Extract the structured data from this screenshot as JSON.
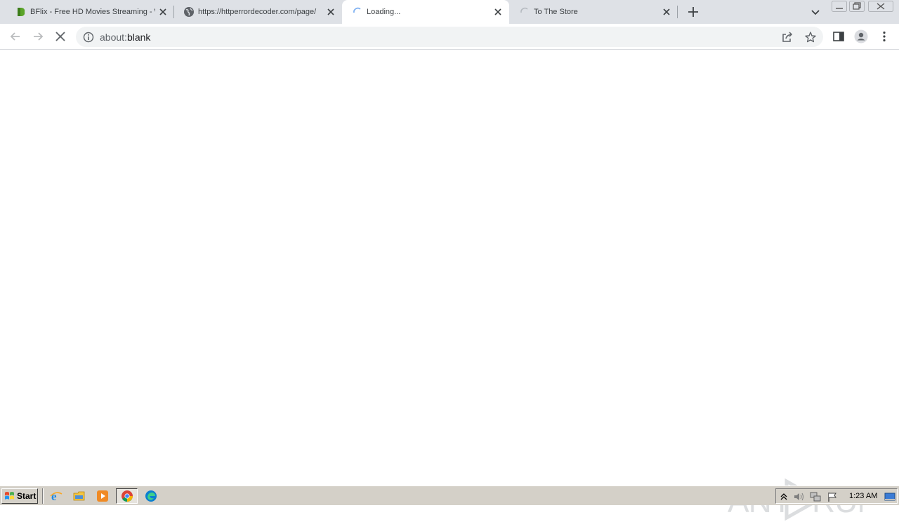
{
  "browser": {
    "tabs": [
      {
        "title": "BFlix - Free HD Movies Streaming - W",
        "favicon": "bflix-favicon",
        "active": false
      },
      {
        "title": "https://httperrordecoder.com/page/",
        "favicon": "globe-icon",
        "active": false
      },
      {
        "title": "Loading...",
        "favicon": "loading-spinner-icon",
        "active": true
      },
      {
        "title": "To The Store",
        "favicon": "loading-spinner-icon",
        "active": false
      }
    ],
    "address_bar": {
      "scheme": "about:",
      "rest": "blank"
    }
  },
  "watermark": {
    "text": "ANY RUN"
  },
  "taskbar": {
    "start_label": "Start",
    "quick_launch": [
      "internet-explorer-icon",
      "file-explorer-icon",
      "media-player-icon",
      "chrome-icon",
      "edge-icon"
    ],
    "clock": "1:23 AM"
  },
  "colors": {
    "tabstrip": "#dee1e6",
    "omnibox": "#f1f3f4",
    "taskbar": "#d4d0c8",
    "icon": "#5f6368"
  }
}
